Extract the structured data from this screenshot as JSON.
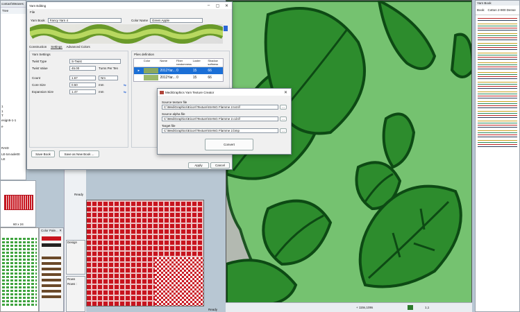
{
  "top_left": {
    "path_text": "contact\\Weaves",
    "tree_tab": "Tree",
    "tab2": "Pr"
  },
  "left_texts": [
    "1",
    "1",
    "T",
    "esign5-1-1",
    "e",
    "RAID",
    "LE-txt-axle00",
    "LE"
  ],
  "thumb_label": "60 x 24",
  "color_palette": {
    "title": "Color Pale..."
  },
  "yarn_editing": {
    "title": "Yarn Editing",
    "menu_file": "File",
    "yarn_book_label": "Yarn Book",
    "yarn_book_value": "Fancy Yarn 4",
    "color_name_label": "Color Name",
    "color_name_value": "Green Apple",
    "tabs": [
      "Construction",
      "Settings",
      "Advanced Colors"
    ],
    "yarn_settings_title": "Yarn Settings",
    "twist_type_label": "Twist Type",
    "twist_type_value": "S-Twist",
    "twist_value_label": "Twist Value",
    "twist_value": "45.00",
    "twist_unit": "Turns Per Ten",
    "count_label": "Count",
    "count_value": "1.67",
    "count_unit": "Nm",
    "core_size_label": "Core Size",
    "core_size_value": "0.50",
    "core_size_unit": "mm",
    "expansion_label": "Expansion Size",
    "expansion_value": "1.47",
    "expansion_unit": "mm",
    "plies_title": "Plies definition",
    "plies_headers": [
      "Color",
      "Name",
      "Fiber randomness",
      "Luster",
      "Shadow softness"
    ],
    "plies_rows": [
      {
        "name": "2012Yar...",
        "fiber": "0",
        "luster": "15",
        "shadow": "66"
      },
      {
        "name": "2012Yar...",
        "fiber": "0",
        "luster": "15",
        "shadow": "66"
      }
    ],
    "save_book": "Save Book",
    "save_new_book": "Save as New Book ...",
    "apply": "Apply",
    "cancel": "Cancel"
  },
  "texture_creator": {
    "title": "MediGraphics Yarn Texture Creator",
    "src_texture_label": "Source texture file",
    "src_texture_value": "C:\\MediGraphics\\Eicorr\\Texture\\SIANG Flamme 2.txt.tif",
    "src_alpha_label": "Source alpha file",
    "src_alpha_value": "C:\\MediGraphics\\Eicorr\\Texture\\SIANG Flamme 2.cd.tif",
    "target_label": "Target file",
    "target_value": "C:\\MediGraphics\\Eicorr\\Texture\\SIANG Flamme 2.bmp",
    "browse": "...",
    "convert": "Convert"
  },
  "mid": {
    "ready1": "Ready",
    "design_title": "Design",
    "rows_title": "Rows",
    "rows_label": "Rows :",
    "ready2": "Ready"
  },
  "status": {
    "coords": "+ 115s,108s",
    "page": "1,1"
  },
  "yarn_book": {
    "title": "Yarn Book",
    "tab1": "Book:",
    "tab2": "Cotton 2-900 Dense"
  },
  "colors": {
    "dark_green": "#0d4a14",
    "mid_green": "#2d8c2d",
    "light_green": "#6fc46a",
    "canvas_bg": "#b3b9b1",
    "red": "#c8141e"
  }
}
